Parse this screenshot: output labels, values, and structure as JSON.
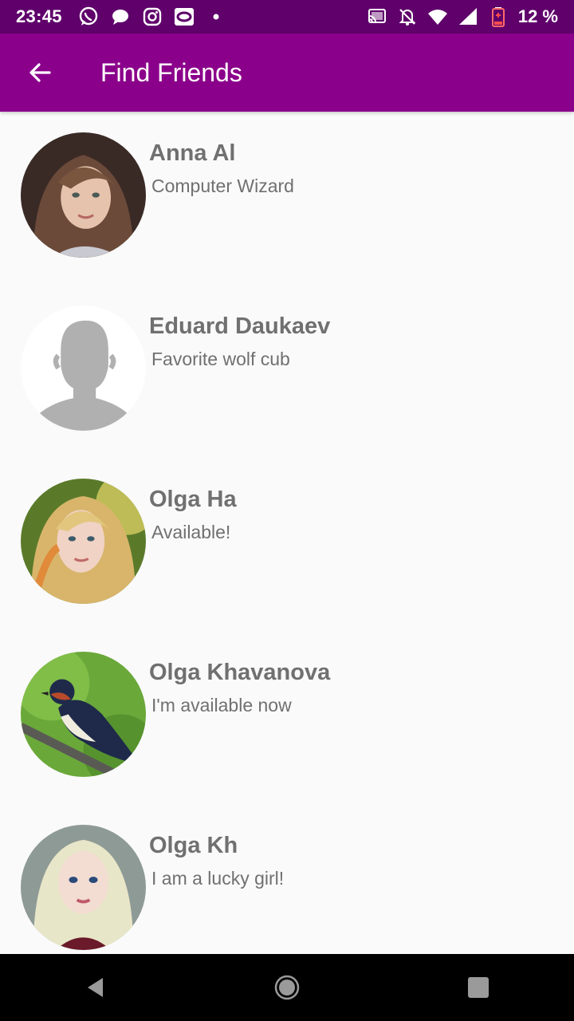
{
  "status_bar": {
    "time": "23:45",
    "battery_text": "12 %",
    "icons_left": [
      "whatsapp-icon",
      "chat-bubble-icon",
      "instagram-icon",
      "oval-app-icon",
      "dot-icon"
    ],
    "icons_right": [
      "cast-icon",
      "mute-icon",
      "wifi-icon",
      "signal-icon",
      "battery-low-icon"
    ]
  },
  "app_bar": {
    "title": "Find Friends",
    "back_icon": "arrow-back-icon",
    "color": "#8b008b"
  },
  "friends": [
    {
      "name": "Anna Al",
      "status": "Computer Wizard",
      "avatar": "photo-woman-brown-hair"
    },
    {
      "name": "Eduard Daukaev",
      "status": "Favorite wolf cub",
      "avatar": "default-profile-silhouette"
    },
    {
      "name": "Olga Ha",
      "status": "Available!",
      "avatar": "photo-woman-blonde-sunlit"
    },
    {
      "name": "Olga Khavanova",
      "status": "I'm available now",
      "avatar": "photo-swallow-bird"
    },
    {
      "name": "Olga Kh",
      "status": "I am a lucky girl!",
      "avatar": "photo-woman-platinum-hair"
    }
  ],
  "nav_bar": {
    "buttons": [
      "back-triangle-icon",
      "home-circle-icon",
      "recents-square-icon"
    ]
  }
}
